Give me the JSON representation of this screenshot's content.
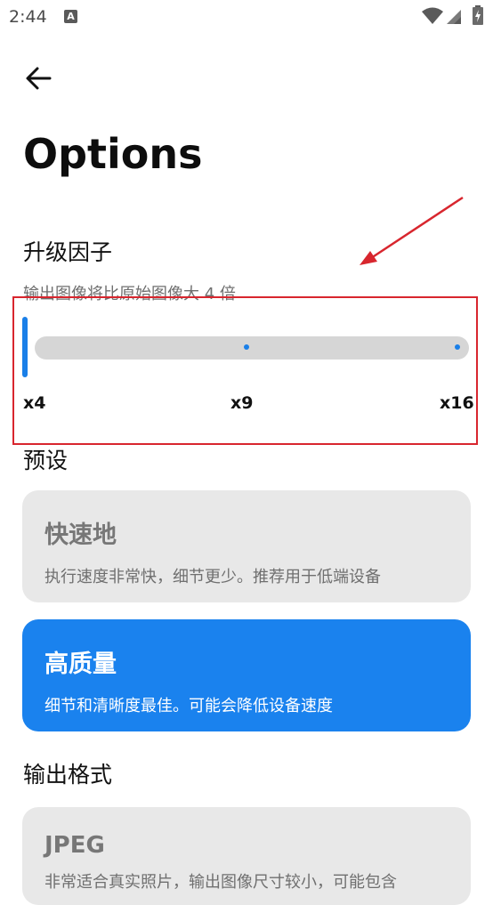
{
  "status_bar": {
    "time": "2:44",
    "notification_icon": "A",
    "icons": [
      "wifi-icon",
      "signal-icon",
      "battery-icon"
    ]
  },
  "header": {
    "back_icon": "arrow-left-icon",
    "title": "Options"
  },
  "upscale": {
    "title": "升级因子",
    "description": "输出图像将比原始图像大 4 倍",
    "slider": {
      "value": "x4",
      "ticks": [
        "x4",
        "x9",
        "x16"
      ]
    }
  },
  "preset": {
    "title": "预设",
    "options": [
      {
        "title": "快速地",
        "description": "执行速度非常快，细节更少。推荐用于低端设备",
        "selected": false
      },
      {
        "title": "高质量",
        "description": "细节和清晰度最佳。可能会降低设备速度",
        "selected": true
      }
    ]
  },
  "output_format": {
    "title": "输出格式",
    "options": [
      {
        "title": "JPEG",
        "description": "非常适合真实照片，输出图像尺寸较小，可能包含"
      }
    ]
  },
  "colors": {
    "accent": "#1a82ee",
    "annotation": "#d8262e",
    "card_bg": "#e8e8e8",
    "track": "#d6d6d6"
  }
}
